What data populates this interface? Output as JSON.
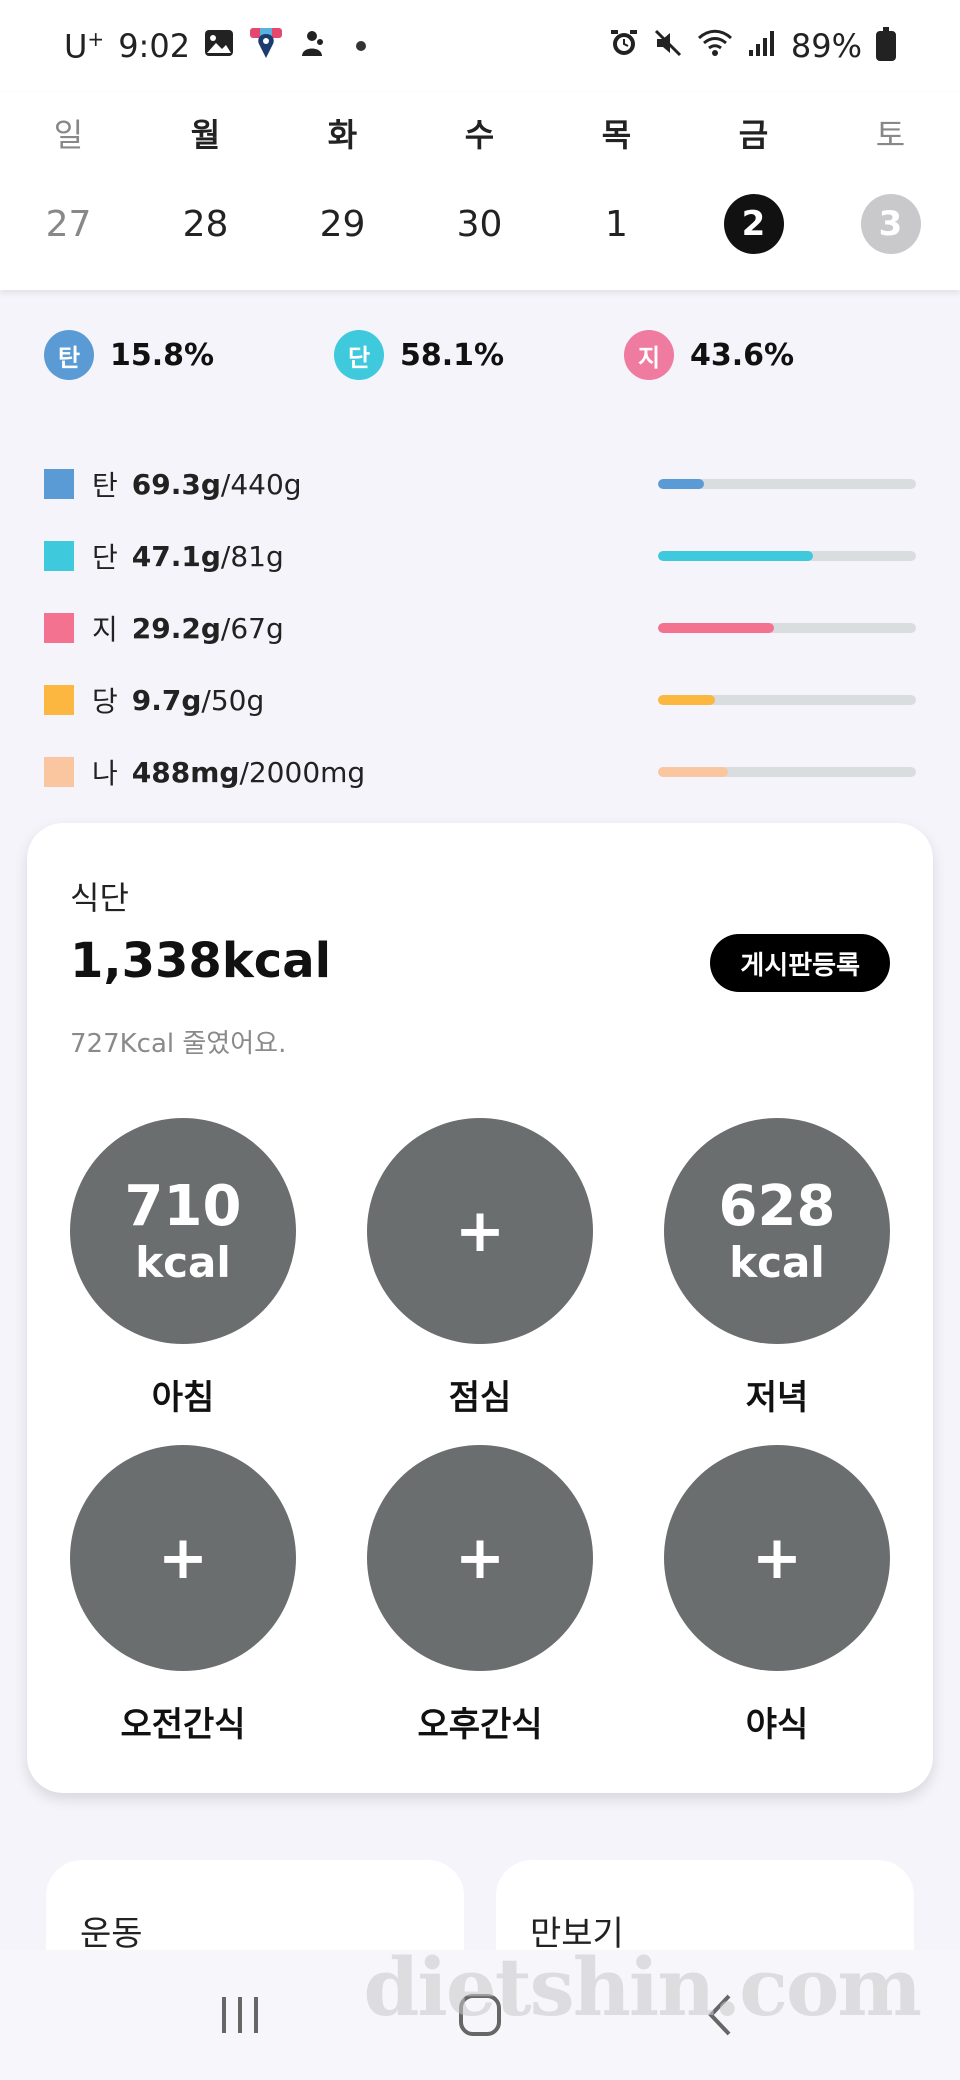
{
  "status_bar": {
    "carrier": "U",
    "carrier_sup": "+",
    "time": "9:02",
    "battery": "89%"
  },
  "week": {
    "days": [
      "일",
      "월",
      "화",
      "수",
      "목",
      "금",
      "토"
    ],
    "dates": [
      "27",
      "28",
      "29",
      "30",
      "1",
      "2",
      "3"
    ],
    "selected_index": 5
  },
  "macro_pct": [
    {
      "badge": "탄",
      "value": "15.8%",
      "color": "#5b9bd5"
    },
    {
      "badge": "단",
      "value": "58.1%",
      "color": "#3fc9dc"
    },
    {
      "badge": "지",
      "value": "43.6%",
      "color": "#f07ba0"
    }
  ],
  "nutrients": [
    {
      "name": "탄",
      "amount": "69.3g",
      "goal": "/440g",
      "color": "#5b9bd5",
      "progress": 0.18
    },
    {
      "name": "단",
      "amount": "47.1g",
      "goal": "/81g",
      "color": "#3fc9dc",
      "progress": 0.6
    },
    {
      "name": "지",
      "amount": "29.2g",
      "goal": "/67g",
      "color": "#f2728f",
      "progress": 0.45
    },
    {
      "name": "당",
      "amount": "9.7g",
      "goal": "/50g",
      "color": "#fbb740",
      "progress": 0.22
    },
    {
      "name": "나",
      "amount": "488mg",
      "goal": "/2000mg",
      "color": "#f9c6a0",
      "progress": 0.27
    }
  ],
  "diet": {
    "title": "식단",
    "total_kcal": "1,338kcal",
    "board_button": "게시판등록",
    "subtitle": "727Kcal 줄였어요.",
    "meals": [
      {
        "label": "아침",
        "kcal": "710",
        "unit": "kcal"
      },
      {
        "label": "점심",
        "kcal": null,
        "plus": "+"
      },
      {
        "label": "저녁",
        "kcal": "628",
        "unit": "kcal"
      },
      {
        "label": "오전간식",
        "kcal": null,
        "plus": "+"
      },
      {
        "label": "오후간식",
        "kcal": null,
        "plus": "+"
      },
      {
        "label": "야식",
        "kcal": null,
        "plus": "+"
      }
    ]
  },
  "bottom_cards": {
    "exercise": "운동",
    "pedometer": "만보기"
  },
  "watermark": "dietshin.com"
}
